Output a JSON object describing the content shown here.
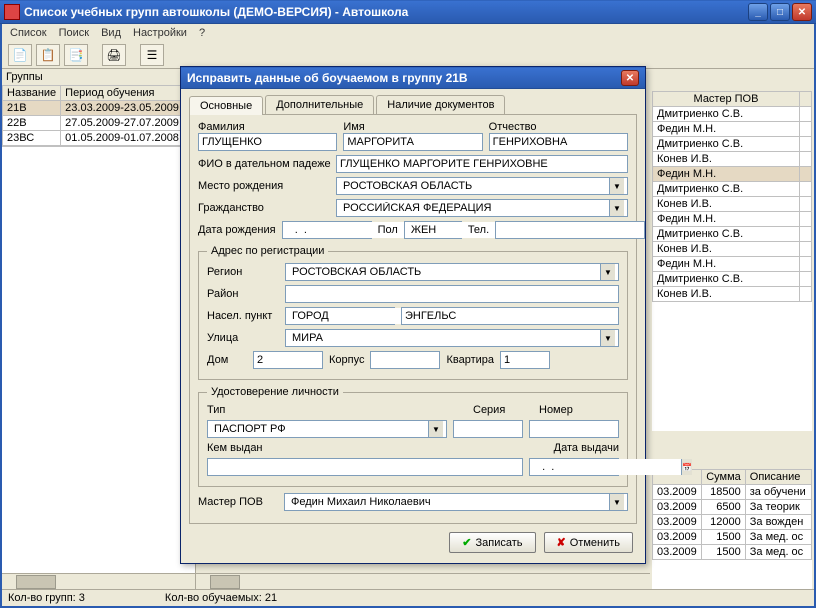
{
  "window": {
    "title": "Список учебных групп автошколы (ДЕМО-ВЕРСИЯ) - Автошкола"
  },
  "menu": {
    "list": "Список",
    "search": "Поиск",
    "view": "Вид",
    "settings": "Настройки",
    "help": "?"
  },
  "groups_pane": {
    "header": "Группы",
    "col_name": "Название",
    "col_period": "Период обучения",
    "rows": [
      {
        "name": "21В",
        "period": "23.03.2009-23.05.2009"
      },
      {
        "name": "22В",
        "period": "27.05.2009-27.07.2009"
      },
      {
        "name": "23ВС",
        "period": "01.05.2009-01.07.2008"
      }
    ]
  },
  "right_grid": {
    "col_master": "Мастер ПОВ",
    "rows": [
      "Дмитриенко С.В.",
      "Федин М.Н.",
      "Дмитриенко С.В.",
      "Конев И.В.",
      "Федин М.Н.",
      "Дмитриенко С.В.",
      "Конев И.В.",
      "Федин М.Н.",
      "Дмитриенко С.В.",
      "Конев И.В.",
      "Федин М.Н.",
      "Дмитриенко С.В.",
      "Конев И.В."
    ]
  },
  "payments": {
    "col_date_suffix": "3.2009",
    "col_sum": "Сумма",
    "col_desc": "Описание",
    "rows": [
      {
        "d": "03.2009",
        "sum": "18500",
        "desc": "за обучени"
      },
      {
        "d": "03.2009",
        "sum": "6500",
        "desc": "За теорик"
      },
      {
        "d": "03.2009",
        "sum": "12000",
        "desc": "За вожден"
      },
      {
        "d": "03.2009",
        "sum": "1500",
        "desc": "За мед. ос"
      },
      {
        "d": "03.2009",
        "sum": "1500",
        "desc": "За мед. ос"
      }
    ]
  },
  "statusbar": {
    "groups": "Кол-во групп:   3",
    "students": "Кол-во обучаемых:  21"
  },
  "dialog": {
    "title": "Исправить данные об боучаемом в группу 21В",
    "tabs": {
      "main": "Основные",
      "extra": "Дополнительные",
      "docs": "Наличие документов"
    },
    "labels": {
      "surname": "Фамилия",
      "name": "Имя",
      "patronymic": "Отчество",
      "fio_dat": "ФИО в дательном падеже",
      "birthplace": "Место рождения",
      "citizenship": "Гражданство",
      "birthdate": "Дата рождения",
      "sex": "Пол",
      "tel": "Тел.",
      "addr_group": "Адрес по регистрации",
      "region": "Регион",
      "district": "Район",
      "settlement": "Насел. пункт",
      "street": "Улица",
      "house": "Дом",
      "building": "Корпус",
      "flat": "Квартира",
      "id_group": "Удостоверение личности",
      "id_type": "Тип",
      "id_series": "Серия",
      "id_number": "Номер",
      "issued_by": "Кем выдан",
      "issue_date": "Дата выдачи",
      "master": "Мастер ПОВ",
      "save": "Записать",
      "cancel": "Отменить"
    },
    "values": {
      "surname": "ГЛУЩЕНКО",
      "name": "МАРГОРИТА",
      "patronymic": "ГЕНРИХОВНА",
      "fio_dat": "ГЛУЩЕНКО МАРГОРИТЕ ГЕНРИХОВНЕ",
      "birthplace": "РОСТОВСКАЯ ОБЛАСТЬ",
      "citizenship": "РОССИЙСКАЯ ФЕДЕРАЦИЯ",
      "birthdate": "  .  .    ",
      "sex": "ЖЕН",
      "tel": "",
      "region": "РОСТОВСКАЯ ОБЛАСТЬ",
      "district": "",
      "settlement_type": "ГОРОД",
      "settlement": "ЭНГЕЛЬС",
      "street": "МИРА",
      "house": "2",
      "building": "",
      "flat": "1",
      "id_type": "ПАСПОРТ РФ",
      "id_series": "",
      "id_number": "",
      "issued_by": "",
      "issue_date": "  .  .    ",
      "master": "Федин Михаил Николаевич"
    }
  }
}
